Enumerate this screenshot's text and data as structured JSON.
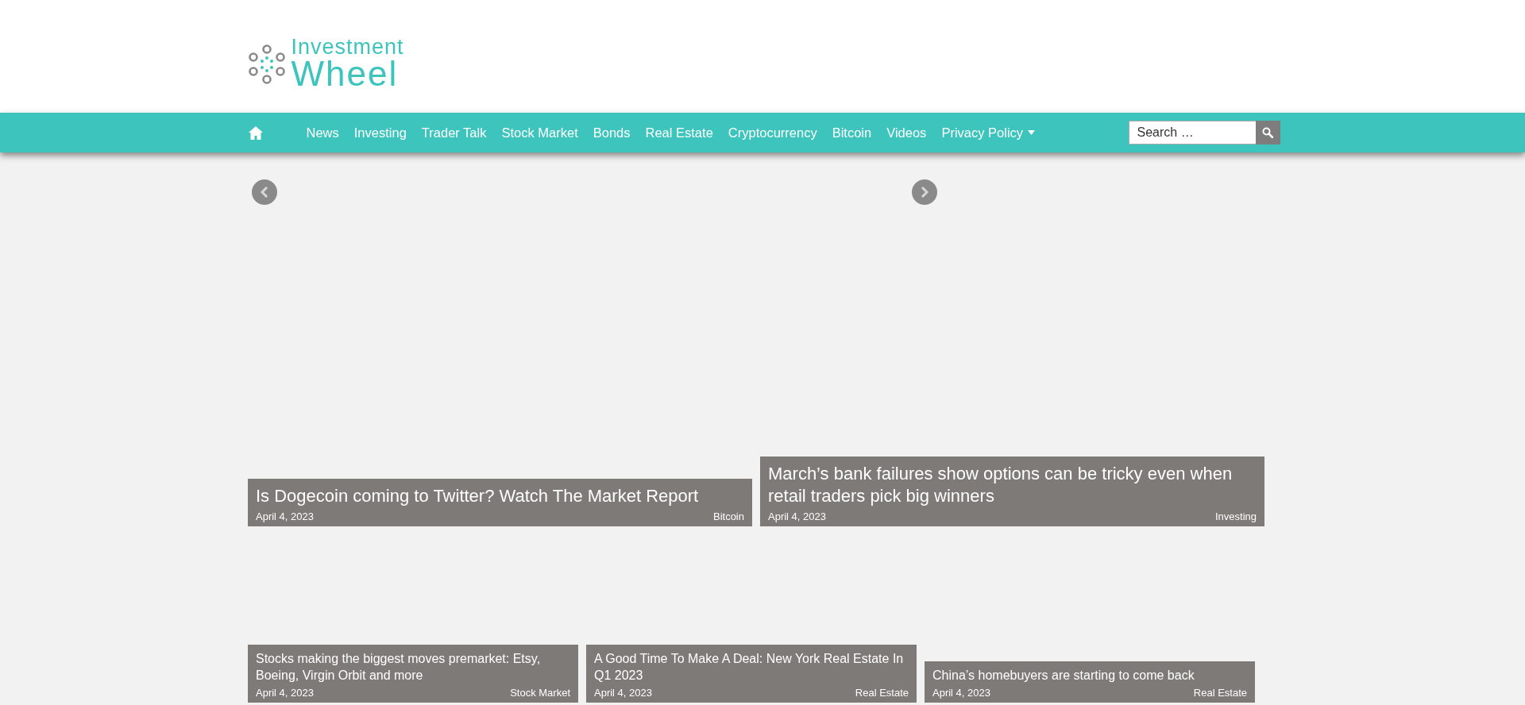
{
  "logo": {
    "line_1": "Investment",
    "line_2": "Wheel"
  },
  "nav": {
    "items": [
      {
        "kind": "home"
      },
      {
        "kind": "link",
        "label": "News"
      },
      {
        "kind": "link",
        "label": "Investing"
      },
      {
        "kind": "link",
        "label": "Trader Talk"
      },
      {
        "kind": "link",
        "label": "Stock Market"
      },
      {
        "kind": "link",
        "label": "Bonds"
      },
      {
        "kind": "link",
        "label": "Real Estate"
      },
      {
        "kind": "link",
        "label": "Cryptocurrency"
      },
      {
        "kind": "link",
        "label": "Bitcoin"
      },
      {
        "kind": "link",
        "label": "Videos"
      },
      {
        "kind": "dropdown",
        "label": "Privacy Policy"
      }
    ],
    "search": {
      "placeholder": "Search …"
    }
  },
  "slider": {
    "slides": [
      {
        "title": "Is Dogecoin coming to Twitter? Watch The Market Report",
        "date": "April 4, 2023",
        "category": "Bitcoin"
      },
      {
        "title": "March’s bank failures show options can be tricky even when retail traders pick big winners",
        "date": "April 4, 2023",
        "category": "Investing"
      }
    ]
  },
  "posts": [
    {
      "title": "Stocks making the biggest moves premarket: Etsy, Boeing, Virgin Orbit and more",
      "date": "April 4, 2023",
      "category": "Stock Market"
    },
    {
      "title": "A Good Time To Make A Deal: New York Real Estate In Q1 2023",
      "date": "April 4, 2023",
      "category": "Real Estate"
    },
    {
      "title": "China’s homebuyers are starting to come back",
      "date": "April 4, 2023",
      "category": "Real Estate"
    }
  ]
}
